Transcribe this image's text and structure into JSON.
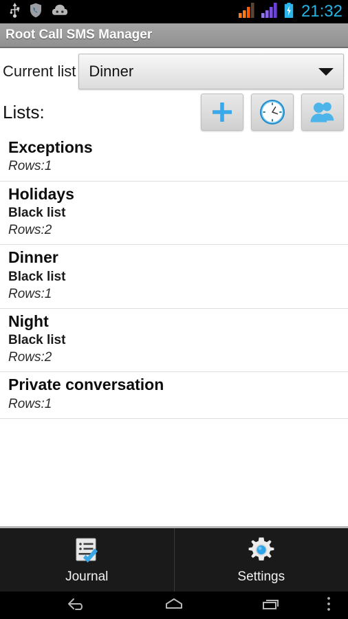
{
  "statusbar": {
    "icons": [
      "usb-icon",
      "shield-phone-icon",
      "android-robot-icon"
    ],
    "signal_icons": [
      "signal-bars-orange-icon",
      "signal-bars-purple-icon"
    ],
    "battery_icon": "battery-charging-icon",
    "clock": "21:32"
  },
  "titlebar": {
    "title": "Root Call SMS Manager"
  },
  "current_list": {
    "label": "Current list",
    "selected": "Dinner",
    "caret_icon": "chevron-down-icon"
  },
  "lists_section": {
    "label": "Lists:",
    "actions": [
      {
        "name": "add-list-button",
        "icon": "plus-icon"
      },
      {
        "name": "schedule-button",
        "icon": "clock-icon"
      },
      {
        "name": "contacts-button",
        "icon": "contacts-icon"
      }
    ]
  },
  "lists": [
    {
      "title": "Exceptions",
      "type": "",
      "rows": "Rows:1"
    },
    {
      "title": "Holidays",
      "type": "Black list",
      "rows": "Rows:2"
    },
    {
      "title": "Dinner",
      "type": "Black list",
      "rows": "Rows:1"
    },
    {
      "title": "Night",
      "type": "Black list",
      "rows": "Rows:2"
    },
    {
      "title": "Private conversation",
      "type": "",
      "rows": "Rows:1"
    }
  ],
  "tabs": [
    {
      "label": "Journal",
      "icon": "journal-checklist-icon"
    },
    {
      "label": "Settings",
      "icon": "gear-icon"
    }
  ],
  "navbar": {
    "back": "back-icon",
    "home": "home-icon",
    "recents": "recents-icon",
    "menu": "overflow-menu-icon"
  },
  "colors": {
    "accent_blue": "#37a8e8",
    "clock_blue": "#23b4e8",
    "titlebar_gray": "#9a9a9a",
    "tabbar_dark": "#1a1a1a"
  }
}
